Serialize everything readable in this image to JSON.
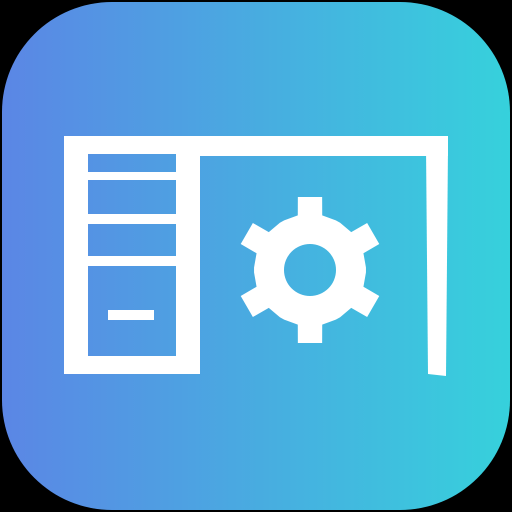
{
  "app_icon": {
    "icon_name": "desk-settings-icon",
    "parts": [
      "app-icon-background",
      "desk-icon",
      "drawer-cabinet-icon",
      "gear-icon"
    ],
    "colors": {
      "gradient_start": "#5B86E5",
      "gradient_end": "#36D1DC",
      "glyph": "#FFFFFF",
      "canvas": "#000000"
    }
  }
}
